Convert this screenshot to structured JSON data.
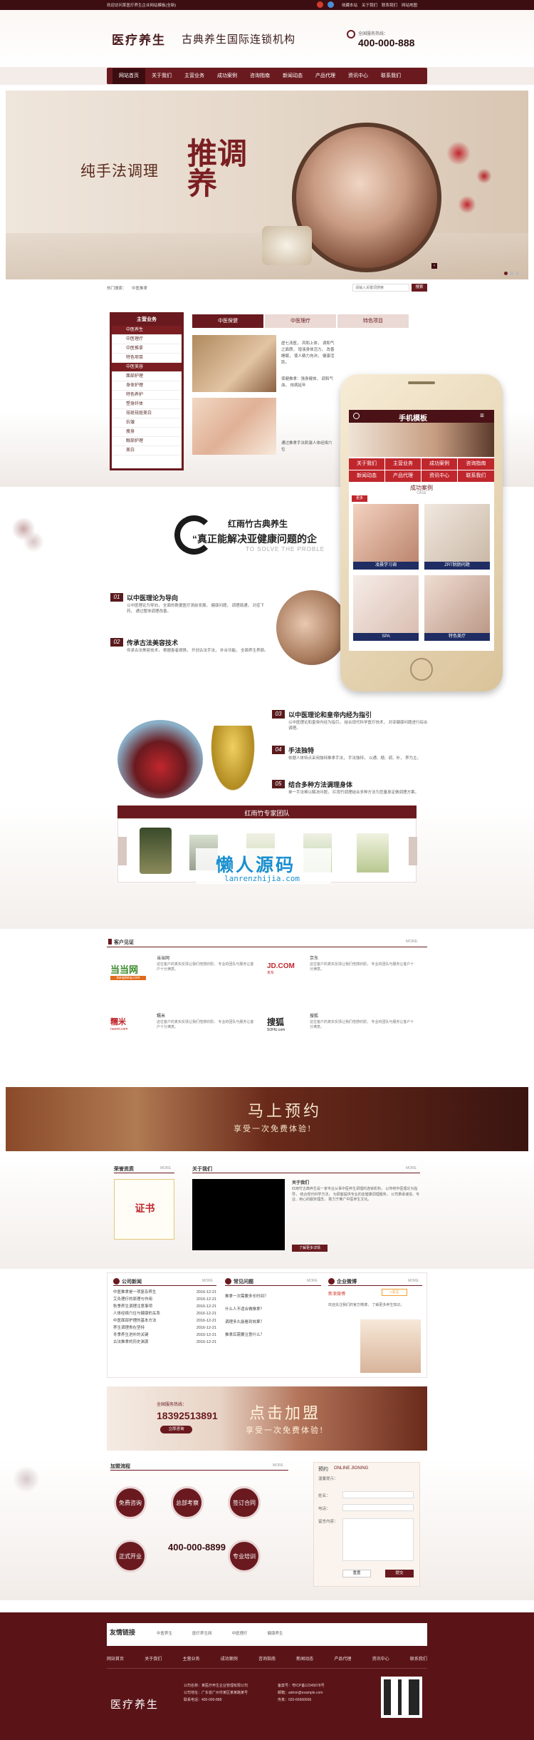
{
  "colors": {
    "primary": "#6a1a1f",
    "dark": "#3c0e12",
    "accent": "#c0272d",
    "bg_light": "#f4efec"
  },
  "topbar": {
    "welcome": "欢迎访问某医疗养生企业网站模板(全新)",
    "links": [
      "收藏本站",
      "关于我们",
      "联系我们",
      "网站地图"
    ]
  },
  "header": {
    "logo": "医疗养生",
    "slogan": "古典养生国际连锁机构",
    "hotline_label": "全国服务热线：",
    "hotline": "400-000-888"
  },
  "nav": {
    "items": [
      "网站首页",
      "关于我们",
      "主营业务",
      "成功案例",
      "咨询指南",
      "新闻动态",
      "产品代理",
      "资讯中心",
      "联系我们"
    ]
  },
  "banner": {
    "text": "纯手法调理",
    "big_text": "推调养"
  },
  "searchbar": {
    "hot_label": "热门搜索：",
    "hot_term": "中医推拿",
    "placeholder": "请输入关键词搜索",
    "button": "搜索"
  },
  "main_business": {
    "title": "主营业务",
    "items": [
      "中医养生",
      "中医理疗",
      "中医推拿",
      "特色项目",
      "中医美容",
      "面部护理",
      "身体护理",
      "特色养护",
      "塑身纤体",
      "祛斑祛痘美白",
      "抗皱",
      "瘦身",
      "眼部护理",
      "美白"
    ],
    "highlight_index": [
      0,
      4
    ]
  },
  "tabs": [
    "中医保健",
    "中医理疗",
    "特色项目"
  ],
  "intro_lines": [
    "虚七汤医， 风和上体， 调和气之面质， 增液身体活力， 改善睡眠， 使人精力充沛， 健康活跃。",
    "保健推拿：强身健体， 调和气血， 祛病延年",
    "通过推拿手法刺激人体经络穴位"
  ],
  "phone": {
    "title": "手机模板",
    "menu": [
      "关于我们",
      "主营业务",
      "成功案例",
      "咨询指南",
      "新闻动态",
      "产品代理",
      "资讯中心",
      "联系我们"
    ],
    "case_title": "成功案例",
    "case_sub": "CASE",
    "new_badge": "更多",
    "cases": [
      "凌晨学习调",
      "ZRT脱肠问题",
      "SPA",
      "特色美疗"
    ]
  },
  "about": {
    "brand": "红雨竹古典养生",
    "tagline": "“真正能解决亚健康问题的企",
    "en": "TO SOLVE THE PROBLE",
    "points": [
      {
        "num": "01",
        "title": "以中医理论为导向",
        "desc": "以中医理论为导向， 全面的数据医疗测前发展， 健康问题， 调理疏通， 对症下药， 通过整体调理改善。"
      },
      {
        "num": "02",
        "title": "传承古法美容技术",
        "desc": "传承古法美容技术， 根据患者病情， 开创古法手法， 补合功能， 全面养生养颜。"
      },
      {
        "num": "03",
        "title": "以中医理论和皇帝内经为指引",
        "desc": "以中医理论和皇帝内经为指引， 结合现代科学医疗技术， 对亚健康问题进行综合调理。"
      },
      {
        "num": "04",
        "title": "手法独特",
        "desc": "依据人体特点采用独特推拿手法， 手法独特， 以通、顺、调、补， 养为主。"
      },
      {
        "num": "05",
        "title": "结合多种方法调理身体",
        "desc": "单一手法难以解决问题， 红雨竹调理结合多种方法为您量身定做调理方案。"
      }
    ]
  },
  "team": {
    "title": "红雨竹专家团队"
  },
  "watermark": {
    "cn": "懒人源码",
    "url": "lanrenzhijia.com"
  },
  "testimonials": {
    "title": "客户见证",
    "more": "MORE",
    "items": [
      {
        "logo": "当当网",
        "logo_sub": "dangdang.com",
        "name": "当当网",
        "desc": "这位客户的真实反馈让我们倍感欣慰， 专业的团队与服务让客户十分满意。"
      },
      {
        "logo": "JD.COM",
        "logo_sub": "京东",
        "name": "京东",
        "desc": "这位客户的真实反馈让我们倍感欣慰， 专业的团队与服务让客户十分满意。"
      },
      {
        "logo": "糯米",
        "logo_sub": "nuomi.com",
        "name": "糯米",
        "desc": "这位客户的真实反馈让我们倍感欣慰， 专业的团队与服务让客户十分满意。"
      },
      {
        "logo": "搜狐",
        "logo_sub": "SOHU.com",
        "name": "搜狐",
        "desc": "这位客户的真实反馈让我们倍感欣慰， 专业的团队与服务让客户十分满意。"
      }
    ]
  },
  "booking_banner": {
    "title": "马上预约",
    "sub": "享受一次免费体验!"
  },
  "honors": {
    "title": "荣誉资质",
    "more": "MORE",
    "cert": "证书"
  },
  "company": {
    "title": "关于我们",
    "more": "MORE",
    "heading": "关于我们",
    "desc": "红雨竹古典养生是一家专业从事中医养生调理的连锁机构， 以传统中医理论为指导， 结合现代科学方法， 为顾客提供专业的亚健康调理服务。 公司秉承诚信、专业、用心的服务理念， 致力于推广中医养生文化。",
    "button": "了解更多详情"
  },
  "news": {
    "title": "公司新闻",
    "more": "MORE",
    "items": [
      {
        "t": "中医推拿是一项复杂养生",
        "d": "2016-12-21"
      },
      {
        "t": "艾灸理疗的原理与作用",
        "d": "2016-12-21"
      },
      {
        "t": "秋季养生调理注意事项",
        "d": "2016-12-21"
      },
      {
        "t": "人体经络穴位与健康的关系",
        "d": "2016-12-21"
      },
      {
        "t": "中医面部护理的基本方法",
        "d": "2016-12-21"
      },
      {
        "t": "养生调理贵在坚持",
        "d": "2016-12-21"
      },
      {
        "t": "冬季养生进补的关键",
        "d": "2016-12-21"
      },
      {
        "t": "古法推拿的历史渊源",
        "d": "2016-12-21"
      }
    ]
  },
  "faq": {
    "title": "常见问题",
    "more": "MORE",
    "items": [
      "推拿一次需要多长时间？",
      "什么人不适合做推拿？",
      "调理多久能看到效果？",
      "推拿后需要注意什么？"
    ]
  },
  "weibo": {
    "title": "企业微博",
    "more": "MORE",
    "name": "新浪微博",
    "follow": "+关注",
    "text": "欢迎关注我们的官方微博， 了解更多养生知识。"
  },
  "join_banner": {
    "hotline_label": "全国服务热线：",
    "phone": "18392513891",
    "btn": "立即咨询",
    "title": "点击加盟",
    "sub": "享受一次免费体验!"
  },
  "process": {
    "title": "加盟流程",
    "more": "MORE",
    "steps": [
      "免费咨询",
      "总部考察",
      "签订合同",
      "正式开业",
      "专业培训"
    ],
    "phone_partial": "400-000-8899"
  },
  "message": {
    "title": "预约",
    "en": "ONLINE JIONING",
    "intro": "温馨提示：",
    "fields": [
      "姓名：",
      "电话：",
      "留言内容："
    ],
    "submit": "提交",
    "reset": "重置"
  },
  "friend_links": {
    "title": "友情链接",
    "items": [
      "中医养生",
      "医疗养生网",
      "中医理疗",
      "健康养生"
    ]
  },
  "footer": {
    "nav": [
      "网站首页",
      "关于我们",
      "主营业务",
      "成功案例",
      "咨询指南",
      "新闻动态",
      "产品代理",
      "资讯中心",
      "联系我们"
    ],
    "logo": "医疗养生",
    "info": [
      "公司名称：某医疗养生企业管理有限公司",
      "公司地址：广东省广州市某区某某路某号",
      "联系电话：400-000-888"
    ],
    "info2": [
      "备案号：粤ICP备12345678号",
      "邮箱：admin@example.com",
      "传真：020-66666666"
    ]
  }
}
